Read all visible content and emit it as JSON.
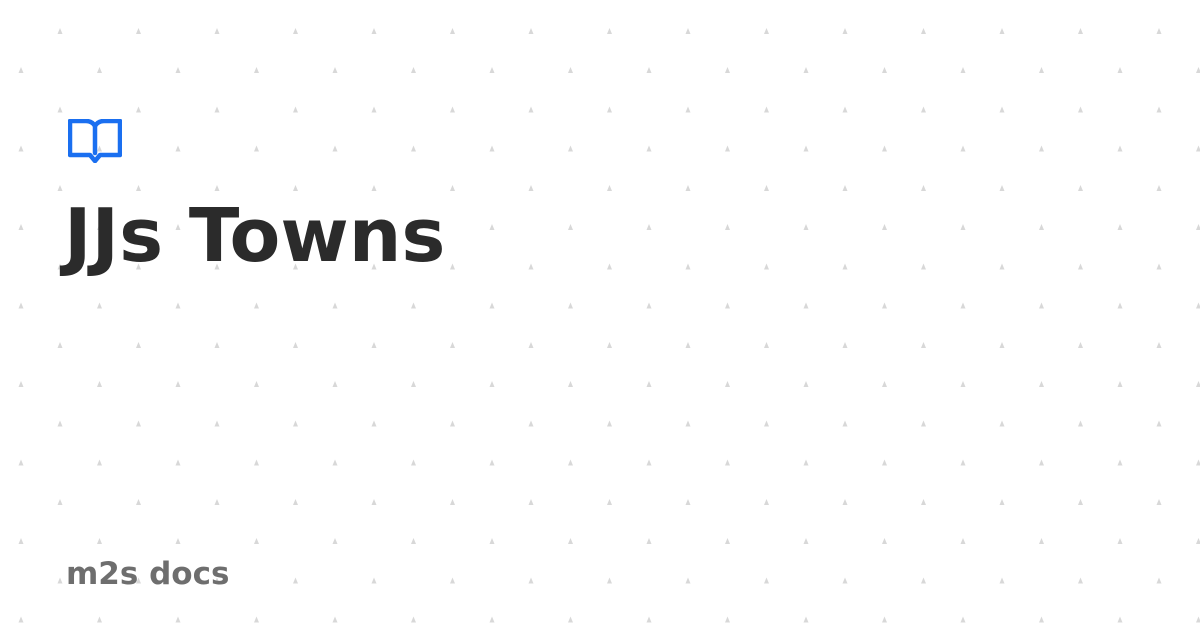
{
  "card": {
    "title": "JJs Towns",
    "footer": "m2s docs"
  },
  "icons": {
    "logo": "book-icon"
  },
  "colors": {
    "accent": "#1a6ff0",
    "title": "#2b2b2b",
    "footer": "#6e6e6e",
    "dots": "#d8d8d8",
    "background": "#ffffff"
  }
}
